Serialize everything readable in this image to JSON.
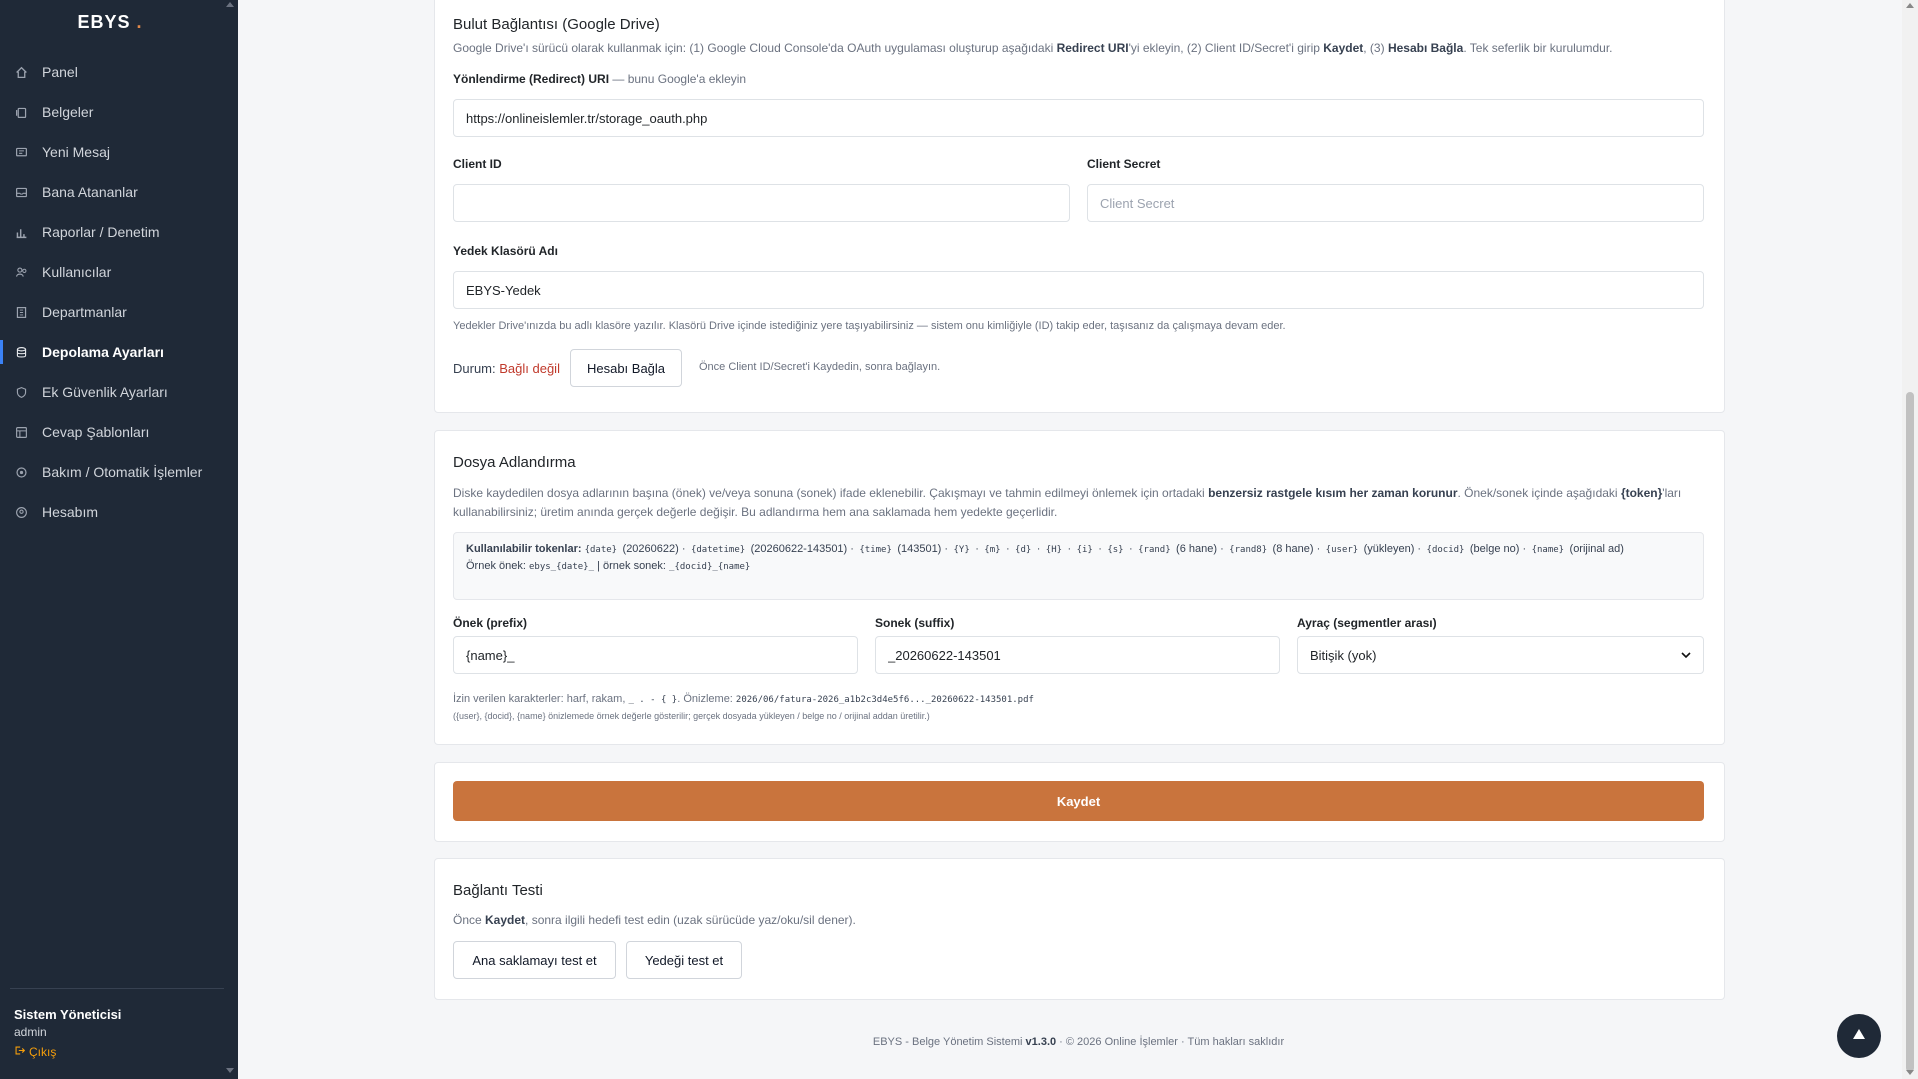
{
  "sidebar": {
    "brand": "EBYS",
    "brand_dot": ".",
    "items": [
      {
        "label": "Panel",
        "icon": "home-icon"
      },
      {
        "label": "Belgeler",
        "icon": "documents-icon"
      },
      {
        "label": "Yeni Mesaj",
        "icon": "message-icon"
      },
      {
        "label": "Bana Atananlar",
        "icon": "inbox-icon"
      },
      {
        "label": "Raporlar / Denetim",
        "icon": "chart-icon"
      },
      {
        "label": "Kullanıcılar",
        "icon": "users-icon"
      },
      {
        "label": "Departmanlar",
        "icon": "building-icon"
      },
      {
        "label": "Depolama Ayarları",
        "icon": "database-icon"
      },
      {
        "label": "Ek Güvenlik Ayarları",
        "icon": "shield-icon"
      },
      {
        "label": "Cevap Şablonları",
        "icon": "template-icon"
      },
      {
        "label": "Bakım / Otomatik İşlemler",
        "icon": "gear-icon"
      },
      {
        "label": "Hesabım",
        "icon": "account-icon"
      }
    ],
    "active_index": 7,
    "user_name": "Sistem Yöneticisi",
    "user_role": "admin",
    "logout_label": "Çıkış"
  },
  "cloud": {
    "title": "Bulut Bağlantısı (Google Drive)",
    "desc_1": "Google Drive'ı sürücü olarak kullanmak için: (1) Google Cloud Console'da OAuth uygulaması oluşturup aşağıdaki ",
    "desc_b1": "Redirect URI",
    "desc_2": "'yi ekleyin, (2) Client ID/Secret'i girip ",
    "desc_b2": "Kaydet",
    "desc_3": ", (3) ",
    "desc_b3": "Hesabı Bağla",
    "desc_4": ". Tek seferlik bir kurulumdur.",
    "redirect_label": "Yönlendirme (Redirect) URI",
    "redirect_hint": " — bunu Google'a ekleyin",
    "redirect_value": "https://onlineislemler.tr/storage_oauth.php",
    "client_id_label": "Client ID",
    "client_id_value": "",
    "client_secret_label": "Client Secret",
    "client_secret_placeholder": "Client Secret",
    "folder_label": "Yedek Klasörü Adı",
    "folder_value": "EBYS-Yedek",
    "folder_hint": "Yedekler Drive'ınızda bu adlı klasöre yazılır. Klasörü Drive içinde istediğiniz yere taşıyabilirsiniz — sistem onu kimliğiyle (ID) takip eder, taşısanız da çalışmaya devam eder.",
    "status_label": "Durum:",
    "status_value": "Bağlı değil",
    "connect_button": "Hesabı Bağla",
    "connect_hint": "Önce Client ID/Secret'i Kaydedin, sonra bağlayın."
  },
  "naming": {
    "title": "Dosya Adlandırma",
    "desc_1": "Diske kaydedilen dosya adlarının başına (önek) ve/veya sonuna (sonek) ifade eklenebilir. Çakışmayı ve tahmin edilmeyi önlemek için ortadaki ",
    "desc_b1": "benzersiz rastgele kısım her zaman korunur",
    "desc_2": ". Önek/sonek içinde aşağıdaki",
    "desc_b2": "{token}",
    "desc_3": "'ları kullanabilirsiniz; üretim anında gerçek değerle değişir. Bu adlandırma hem ana saklamada hem yedekte geçerlidir.",
    "tokens_label": "Kullanılabilir tokenlar:",
    "tokens": [
      {
        "code": "{date}",
        "desc": "(20260622)"
      },
      {
        "code": "{datetime}",
        "desc": "(20260622-143501)"
      },
      {
        "code": "{time}",
        "desc": "(143501)"
      },
      {
        "code": "{Y}",
        "desc": ""
      },
      {
        "code": "{m}",
        "desc": ""
      },
      {
        "code": "{d}",
        "desc": ""
      },
      {
        "code": "{H}",
        "desc": ""
      },
      {
        "code": "{i}",
        "desc": ""
      },
      {
        "code": "{s}",
        "desc": ""
      },
      {
        "code": "{rand}",
        "desc": "(6 hane)"
      },
      {
        "code": "{rand8}",
        "desc": "(8 hane)"
      },
      {
        "code": "{user}",
        "desc": "(yükleyen)"
      },
      {
        "code": "{docid}",
        "desc": "(belge no)"
      },
      {
        "code": "{name}",
        "desc": "(orijinal ad)"
      }
    ],
    "example_prefix_label": "Örnek önek:",
    "example_prefix": "ebys_{date}_",
    "example_suffix_label": "| örnek sonek:",
    "example_suffix": "_{docid}_{name}",
    "prefix_label": "Önek (prefix)",
    "prefix_value": "{name}_",
    "suffix_label": "Sonek (suffix)",
    "suffix_value": "_20260622-143501",
    "separator_label": "Ayraç (segmentler arası)",
    "separator_value": "Bitişik (yok)",
    "allowed_1": "İzin verilen karakterler: harf, rakam, ",
    "allowed_code": "_ . - { }",
    "allowed_2": ". Önizleme: ",
    "preview": "2026/06/fatura-2026_a1b2c3d4e5f6..._20260622-143501.pdf",
    "note": "({user}, {docid}, {name} önizlemede örnek değerle gösterilir; gerçek dosyada yükleyen / belge no / orijinal addan üretilir.)"
  },
  "save_button": "Kaydet",
  "test": {
    "title": "Bağlantı Testi",
    "desc_1": "Önce ",
    "desc_b": "Kaydet",
    "desc_2": ", sonra ilgili hedefi test edin (uzak sürücüde yaz/oku/sil dener).",
    "btn_main": "Ana saklamayı test et",
    "btn_backup": "Yedeği test et"
  },
  "footer": {
    "text_1": "EBYS - Belge Yönetim Sistemi ",
    "version": "v1.3.0",
    "text_2": " · © 2026 Online İşlemler · Tüm hakları saklıdır"
  },
  "colors": {
    "accent": "#c9743d",
    "sidebar_bg": "#1f2937",
    "error": "#c0392b"
  }
}
